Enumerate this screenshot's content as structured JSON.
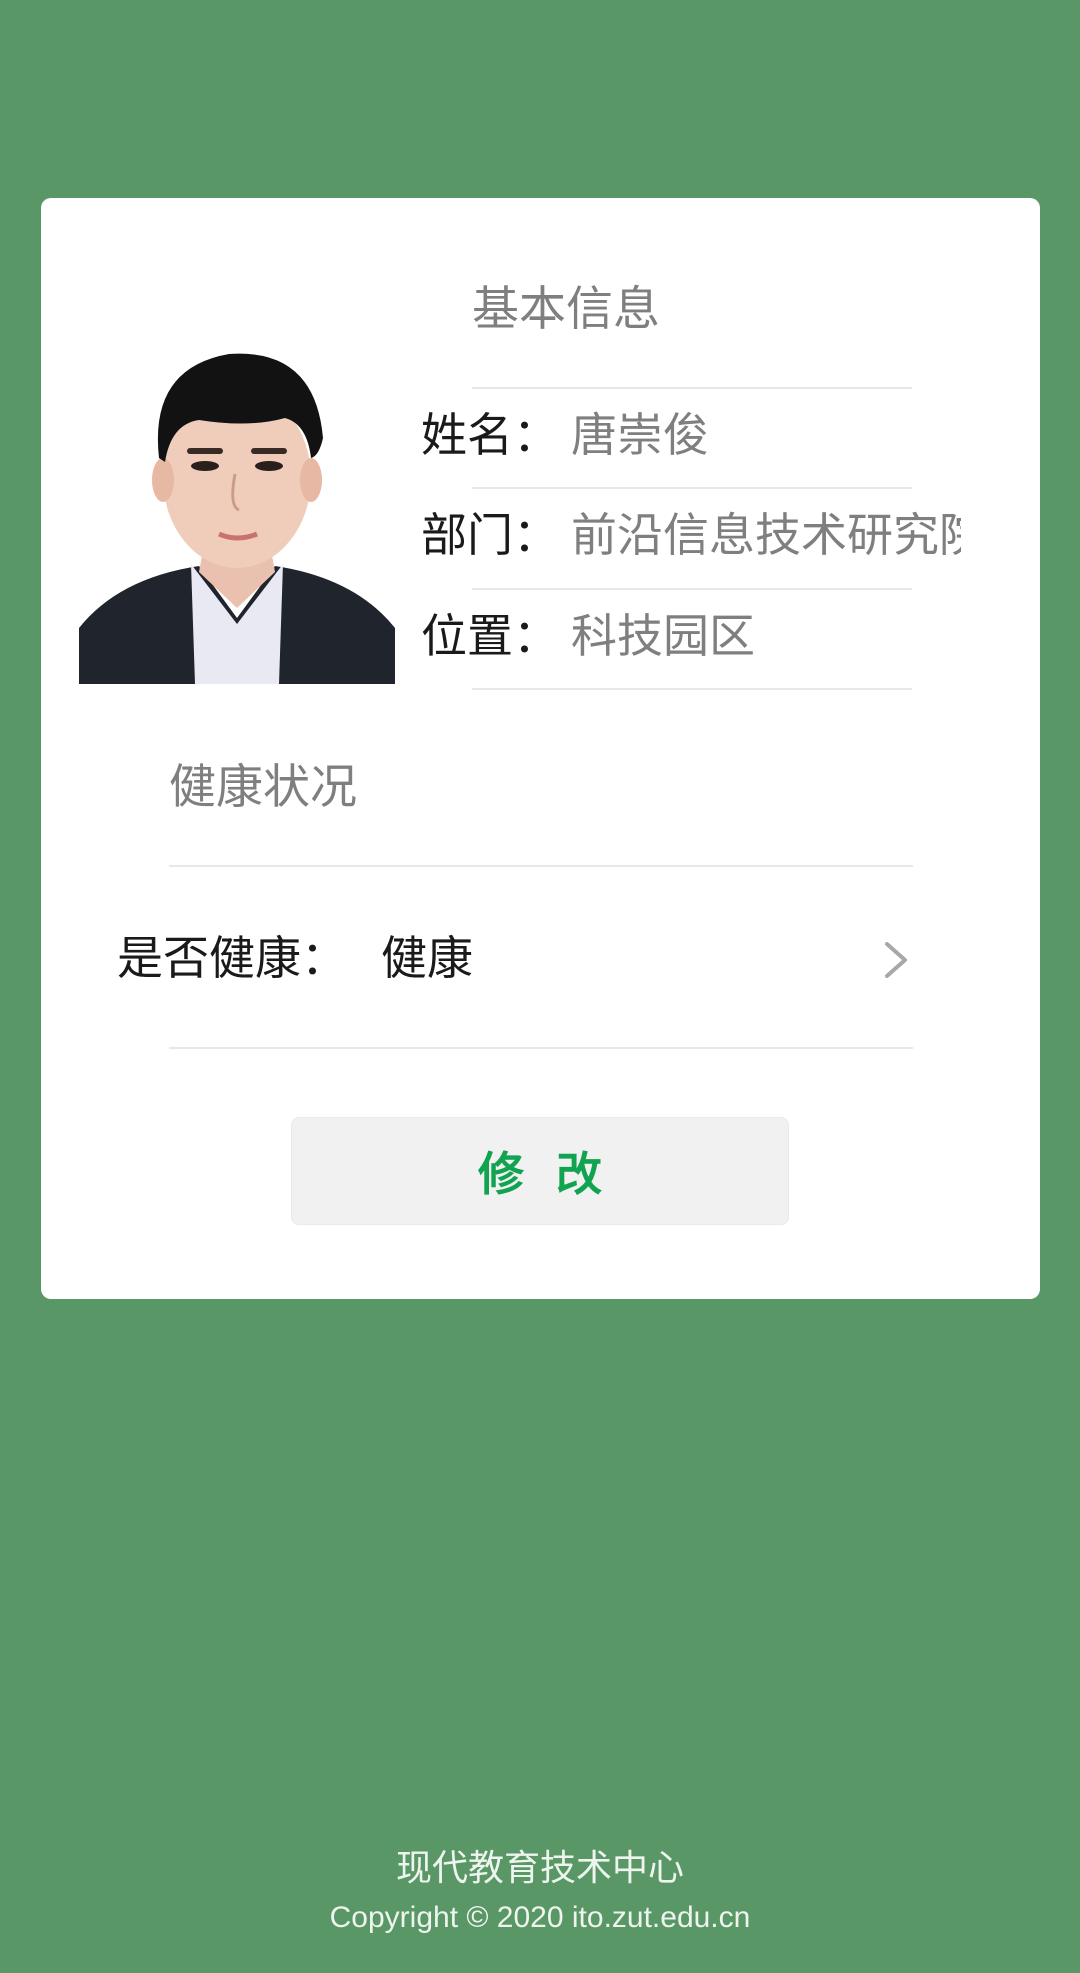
{
  "basic_info": {
    "title": "基本信息",
    "fields": [
      {
        "label": "姓名：",
        "value": "唐崇俊"
      },
      {
        "label": "部门：",
        "value": "前沿信息技术研究院"
      },
      {
        "label": "位置：",
        "value": "科技园区"
      }
    ]
  },
  "health": {
    "title": "健康状况",
    "label": "是否健康：",
    "value": "健康"
  },
  "button": {
    "label": "修改"
  },
  "footer": {
    "org": "现代教育技术中心",
    "copyright": "Copyright © 2020 ito.zut.edu.cn"
  },
  "colors": {
    "background": "#5a9766",
    "accent": "#10a350"
  },
  "icons": {
    "row_arrow": "chevron-right-icon"
  }
}
